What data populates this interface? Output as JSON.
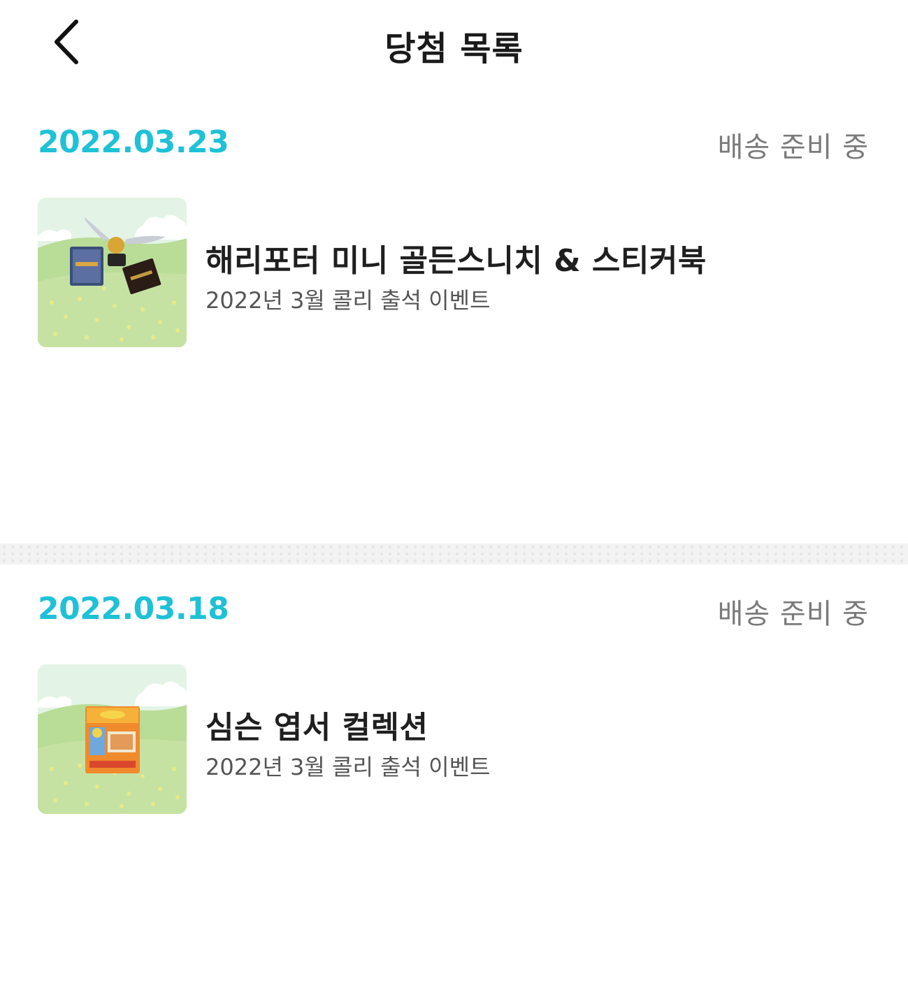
{
  "header": {
    "title": "당첨 목록",
    "back_icon": "chevron-left-icon"
  },
  "sections": [
    {
      "date": "2022.03.23",
      "status": "배송 준비 중",
      "item": {
        "title": "해리포터 미니 골든스니치 & 스티커북",
        "subtitle": "2022년 3월 콜리 출석 이벤트"
      }
    },
    {
      "date": "2022.03.18",
      "status": "배송 준비 중",
      "item": {
        "title": "심슨 엽서 컬렉션",
        "subtitle": "2022년 3월 콜리 출석 이벤트"
      }
    }
  ],
  "colors": {
    "date": "#1fc1d6",
    "status": "#7a7a7a",
    "thumb_sky": "#e3f4e6",
    "thumb_grass": "#b9dc97",
    "thumb_flowers": "#e8ea8a"
  }
}
